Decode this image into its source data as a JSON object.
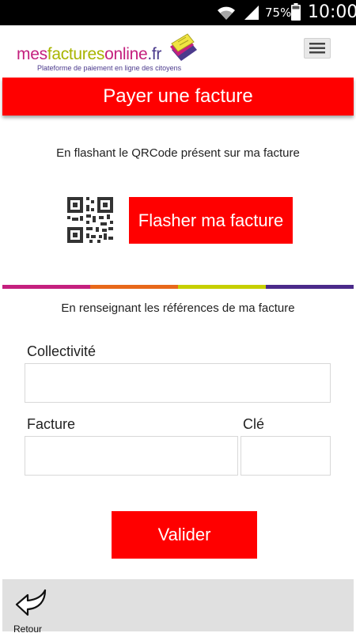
{
  "status_bar": {
    "battery_percent": "75%",
    "time": "10:00",
    "icons": [
      "wifi-icon",
      "signal-icon",
      "battery-icon"
    ]
  },
  "header": {
    "logo_parts": [
      "mes",
      "factures",
      "online",
      ".fr"
    ],
    "tagline": "Plateforme de paiement en ligne des citoyens",
    "menu_icon": "hamburger-menu-icon"
  },
  "title": "Payer une facture",
  "qr_section": {
    "instruction": "En flashant le QRCode présent sur ma facture",
    "button_label": "Flasher ma facture",
    "icon": "qr-code-icon"
  },
  "divider_colors": [
    "#c4207e",
    "#e8681a",
    "#c6cf00",
    "#4b2a8a"
  ],
  "form_section": {
    "instruction": "En renseignant les références de ma facture",
    "collectivite_label": "Collectivité",
    "collectivite_value": "",
    "facture_label": "Facture",
    "facture_value": "",
    "cle_label": "Clé",
    "cle_value": "",
    "submit_label": "Valider"
  },
  "footer": {
    "back_label": "Retour",
    "back_icon": "back-arrow-icon"
  },
  "colors": {
    "primary_red": "#ff0000",
    "brand_magenta": "#c4207e",
    "brand_green": "#a8b400",
    "brand_purple": "#4b3a8c"
  }
}
